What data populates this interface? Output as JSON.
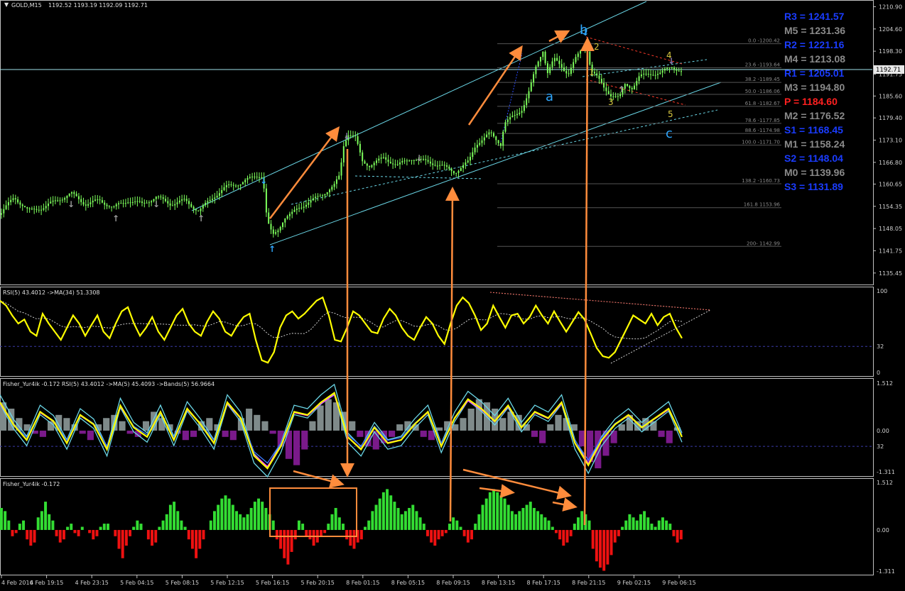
{
  "chart_data": {
    "type": "candlestick",
    "symbol_title": "GOLD,M15",
    "ohlc_header": "1192.52 1193.19 1192.09 1192.71",
    "current_price_label": "1192.71",
    "colors": {
      "background": "#000000",
      "candle": "#7dff5c",
      "axis": "#c0c0c0",
      "channel": "#6ad6e6",
      "arrow": "#ff8c3c",
      "rsi": "#ffff00",
      "fisher_up": "#33dd33",
      "fisher_down": "#ee1111",
      "hist_up": "#7f8a8a",
      "hist_down": "#7a1a8a",
      "label_blue": "#2fa8ff",
      "label_yellow": "#d8c840"
    },
    "price_axis": {
      "ylim": [
        1133.0,
        1212.0
      ],
      "ticks": [
        "1210.90",
        "1204.60",
        "1198.30",
        "1191.75",
        "1185.60",
        "1179.40",
        "1173.10",
        "1166.80",
        "1160.65",
        "1154.35",
        "1148.05",
        "1141.75",
        "1135.45"
      ]
    },
    "price_path": [
      [
        0,
        1152
      ],
      [
        20,
        1157
      ],
      [
        40,
        1153
      ],
      [
        60,
        1154
      ],
      [
        80,
        1156
      ],
      [
        100,
        1158
      ],
      [
        120,
        1155
      ],
      [
        140,
        1156
      ],
      [
        160,
        1154
      ],
      [
        180,
        1156
      ],
      [
        200,
        1155
      ],
      [
        220,
        1157
      ],
      [
        240,
        1155
      ],
      [
        260,
        1156
      ],
      [
        280,
        1153
      ],
      [
        300,
        1157
      ],
      [
        320,
        1160
      ],
      [
        340,
        1161
      ],
      [
        360,
        1163
      ],
      [
        370,
        1163
      ],
      [
        376,
        1150
      ],
      [
        384,
        1146
      ],
      [
        392,
        1148
      ],
      [
        400,
        1151
      ],
      [
        410,
        1152
      ],
      [
        420,
        1154
      ],
      [
        440,
        1156
      ],
      [
        455,
        1158
      ],
      [
        470,
        1160
      ],
      [
        478,
        1163
      ],
      [
        484,
        1172
      ],
      [
        490,
        1175
      ],
      [
        500,
        1174
      ],
      [
        510,
        1167
      ],
      [
        520,
        1166
      ],
      [
        540,
        1168
      ],
      [
        560,
        1166
      ],
      [
        580,
        1168
      ],
      [
        600,
        1167
      ],
      [
        620,
        1166
      ],
      [
        640,
        1164
      ],
      [
        660,
        1167
      ],
      [
        670,
        1172
      ],
      [
        690,
        1175
      ],
      [
        705,
        1172
      ],
      [
        710,
        1178
      ],
      [
        725,
        1180
      ],
      [
        735,
        1182
      ],
      [
        745,
        1187
      ],
      [
        755,
        1194
      ],
      [
        765,
        1199
      ],
      [
        770,
        1192
      ],
      [
        780,
        1196
      ],
      [
        790,
        1194
      ],
      [
        800,
        1192
      ],
      [
        810,
        1196
      ],
      [
        820,
        1199
      ],
      [
        825,
        1201
      ],
      [
        832,
        1193
      ],
      [
        840,
        1191
      ],
      [
        850,
        1188
      ],
      [
        860,
        1186
      ],
      [
        872,
        1185
      ],
      [
        880,
        1189
      ],
      [
        890,
        1188
      ],
      [
        900,
        1191
      ],
      [
        915,
        1192
      ],
      [
        930,
        1192
      ],
      [
        945,
        1194
      ],
      [
        955,
        1193
      ],
      [
        962,
        1192
      ]
    ],
    "fibonacci_levels": [
      {
        "label": "0.0 -1200.42",
        "value": 1200.42
      },
      {
        "label": "23.6 -1193.64",
        "value": 1193.64
      },
      {
        "label": "38.2 -1189.45",
        "value": 1189.45
      },
      {
        "label": "50.0 -1186.06",
        "value": 1186.06
      },
      {
        "label": "61.8 -1182.67",
        "value": 1182.67
      },
      {
        "label": "78.6 -1177.85",
        "value": 1177.85
      },
      {
        "label": "88.6 -1174.98",
        "value": 1174.98
      },
      {
        "label": "100.0 -1171.70",
        "value": 1171.7
      },
      {
        "label": "138.2 -1160.73",
        "value": 1160.73
      },
      {
        "label": "161.8 1153.96",
        "value": 1153.96
      },
      {
        "label": "200- 1142.99",
        "value": 1142.99
      }
    ],
    "pivot_levels": [
      {
        "label": "R3 = 1241.57",
        "color": "#1a3cff"
      },
      {
        "label": "M5 = 1231.36",
        "color": "#8a8a8a"
      },
      {
        "label": "R2 = 1221.16",
        "color": "#1a3cff"
      },
      {
        "label": "M4 = 1213.08",
        "color": "#8a8a8a"
      },
      {
        "label": "R1 = 1205.01",
        "color": "#1a3cff"
      },
      {
        "label": "M3 = 1194.80",
        "color": "#8a8a8a"
      },
      {
        "label": "P   = 1184.60",
        "color": "#ff2020"
      },
      {
        "label": "M2 = 1176.52",
        "color": "#8a8a8a"
      },
      {
        "label": "S1 = 1168.45",
        "color": "#1a3cff"
      },
      {
        "label": "M1 = 1158.24",
        "color": "#8a8a8a"
      },
      {
        "label": "S2 = 1148.04",
        "color": "#1a3cff"
      },
      {
        "label": "M0 = 1139.96",
        "color": "#8a8a8a"
      },
      {
        "label": "S3 = 1131.89",
        "color": "#1a3cff"
      }
    ],
    "wave_labels": [
      {
        "text": "b",
        "color": "#2fa8ff"
      },
      {
        "text": "a",
        "color": "#2fa8ff"
      },
      {
        "text": "c",
        "color": "#2fa8ff"
      },
      {
        "text": "1",
        "color": "#d8c840"
      },
      {
        "text": "2",
        "color": "#d8c840"
      },
      {
        "text": "3",
        "color": "#d8c840"
      },
      {
        "text": "4",
        "color": "#d8c840"
      },
      {
        "text": "5",
        "color": "#d8c840"
      }
    ],
    "rsi_panel": {
      "title": "RSI(5) 43.4012  ->MA(34) 51.3308",
      "ticks": [
        "100",
        "32",
        "0"
      ],
      "ylim": [
        0,
        100
      ],
      "values": [
        88,
        82,
        70,
        60,
        65,
        50,
        45,
        72,
        60,
        50,
        40,
        55,
        70,
        60,
        45,
        58,
        70,
        50,
        42,
        60,
        75,
        80,
        60,
        45,
        55,
        68,
        50,
        40,
        55,
        70,
        78,
        60,
        50,
        45,
        62,
        75,
        66,
        50,
        45,
        58,
        68,
        72,
        40,
        15,
        12,
        25,
        55,
        70,
        75,
        66,
        72,
        80,
        88,
        92,
        70,
        40,
        38,
        55,
        75,
        70,
        60,
        50,
        48,
        66,
        78,
        70,
        55,
        45,
        40,
        55,
        68,
        60,
        45,
        35,
        60,
        82,
        92,
        85,
        70,
        52,
        60,
        82,
        68,
        55,
        70,
        72,
        60,
        68,
        82,
        70,
        60,
        75,
        62,
        50,
        62,
        74,
        65,
        48,
        30,
        20,
        18,
        25,
        40,
        55,
        70,
        65,
        60,
        72,
        58,
        68,
        72,
        55,
        42
      ]
    },
    "fisher_rsi_panel": {
      "title": "Fisher_Yur4ik -0.172  RSI(5) 43.4012  ->MA(5) 45.4093  ->Bands(5) 56.9664",
      "ticks": [
        "1.512",
        "0.00",
        "32",
        "-1.311"
      ],
      "ylim": [
        -1.311,
        1.512
      ],
      "histogram": [
        0.9,
        0.7,
        0.4,
        0.2,
        -0.1,
        -0.2,
        0.3,
        0.5,
        0.4,
        0.2,
        -0.1,
        -0.3,
        0.2,
        0.4,
        0.5,
        0.3,
        -0.1,
        -0.2,
        0.3,
        0.6,
        0.4,
        0.2,
        -0.1,
        -0.3,
        -0.2,
        0.3,
        0.4,
        0.2,
        -0.2,
        -0.3,
        0.4,
        0.7,
        0.5,
        0.3,
        -0.1,
        -0.5,
        -0.9,
        -1.1,
        -0.6,
        0.3,
        0.8,
        1.0,
        0.9,
        0.6,
        0.3,
        -0.2,
        -0.5,
        -0.6,
        -0.4,
        -0.2,
        0.2,
        0.3,
        0.2,
        -0.2,
        -0.3,
        0.1,
        0.3,
        0.2,
        0.4,
        0.7,
        1.0,
        0.9,
        0.7,
        0.4,
        0.6,
        0.5,
        0.2,
        -0.2,
        -0.4,
        0.2,
        0.5,
        0.4,
        0.2,
        -0.5,
        -1.0,
        -1.2,
        -0.8,
        -0.4,
        0.2,
        0.5,
        0.3,
        0.4,
        0.3,
        -0.2,
        -0.4,
        0.1
      ],
      "line": [
        0.9,
        0.2,
        -0.3,
        0.6,
        0.3,
        -0.4,
        0.5,
        0.2,
        -0.6,
        0.8,
        0.1,
        -0.2,
        0.6,
        -0.3,
        0.7,
        0.2,
        -0.4,
        0.9,
        0.4,
        -0.8,
        -1.2,
        -0.5,
        0.6,
        0.5,
        0.9,
        1.2,
        -0.2,
        -0.6,
        0.1,
        -0.4,
        -0.3,
        0.2,
        0.6,
        -0.5,
        0.4,
        1.0,
        0.7,
        0.3,
        0.8,
        0.1,
        0.6,
        0.4,
        0.9,
        -0.4,
        -1.1,
        -0.3,
        0.2,
        0.5,
        0.1,
        0.4,
        0.7,
        -0.2
      ]
    },
    "fisher_panel": {
      "title": "Fisher_Yur4ik -0.172",
      "ticks": [
        "1.512",
        "0.00",
        "-1.311"
      ],
      "ylim": [
        -1.311,
        1.512
      ],
      "values": [
        0.7,
        0.6,
        0.3,
        -0.2,
        -0.1,
        0.2,
        0.3,
        -0.3,
        -0.5,
        -0.4,
        0.4,
        0.6,
        0.9,
        0.5,
        0.3,
        -0.2,
        -0.4,
        -0.3,
        0.1,
        0.2,
        -0.1,
        -0.2,
        0.1,
        0.0,
        -0.1,
        -0.3,
        -0.2,
        0.1,
        0.2,
        0.2,
        0.0,
        -0.2,
        -0.6,
        -0.9,
        -0.5,
        -0.2,
        0.1,
        0.3,
        0.2,
        0.0,
        -0.3,
        -0.5,
        -0.4,
        0.1,
        0.3,
        0.5,
        0.8,
        0.9,
        0.6,
        0.3,
        0.1,
        -0.3,
        -0.6,
        -0.9,
        -0.6,
        -0.3,
        0.0,
        0.3,
        0.6,
        0.8,
        1.0,
        1.1,
        1.0,
        0.8,
        0.6,
        0.5,
        0.4,
        0.5,
        0.7,
        0.9,
        1.0,
        0.9,
        0.7,
        0.5,
        0.3,
        -0.3,
        -0.6,
        -0.9,
        -1.1,
        -0.7,
        -0.3,
        0.3,
        0.2,
        -0.2,
        -0.3,
        -0.5,
        -0.4,
        -0.2,
        -0.1,
        0.2,
        0.5,
        0.7,
        0.4,
        0.2,
        -0.3,
        -0.5,
        -0.6,
        -0.4,
        -0.3,
        0.1,
        0.3,
        0.6,
        0.8,
        1.0,
        1.2,
        1.3,
        1.1,
        0.9,
        0.7,
        0.5,
        0.6,
        0.7,
        0.8,
        0.6,
        0.4,
        0.2,
        -0.2,
        -0.4,
        -0.5,
        -0.3,
        -0.2,
        -0.1,
        0.2,
        0.4,
        0.3,
        0.1,
        -0.2,
        -0.4,
        -0.3,
        0.2,
        0.5,
        0.8,
        1.0,
        1.2,
        1.3,
        1.2,
        1.1,
        1.0,
        0.8,
        0.6,
        0.5,
        0.6,
        0.7,
        0.8,
        0.9,
        0.7,
        0.6,
        0.5,
        0.4,
        0.3,
        0.1,
        -0.1,
        -0.3,
        -0.5,
        -0.4,
        -0.2,
        0.2,
        0.4,
        0.6,
        0.5,
        0.3,
        -0.6,
        -1.0,
        -1.2,
        -1.3,
        -1.1,
        -0.8,
        -0.4,
        -0.2,
        0.1,
        0.3,
        0.5,
        0.4,
        0.3,
        0.5,
        0.6,
        0.4,
        0.2,
        0.1,
        0.3,
        0.4,
        0.3,
        0.2,
        -0.2,
        -0.4,
        -0.3
      ]
    },
    "time_labels": [
      "4 Feb 2016",
      "4 Feb 19:15",
      "4 Feb 23:15",
      "5 Feb 04:15",
      "5 Feb 08:15",
      "5 Feb 12:15",
      "5 Feb 16:15",
      "5 Feb 20:15",
      "8 Feb 01:15",
      "8 Feb 05:15",
      "8 Feb 09:15",
      "8 Feb 13:15",
      "8 Feb 17:15",
      "8 Feb 21:15",
      "9 Feb 02:15",
      "9 Feb 06:15"
    ]
  }
}
